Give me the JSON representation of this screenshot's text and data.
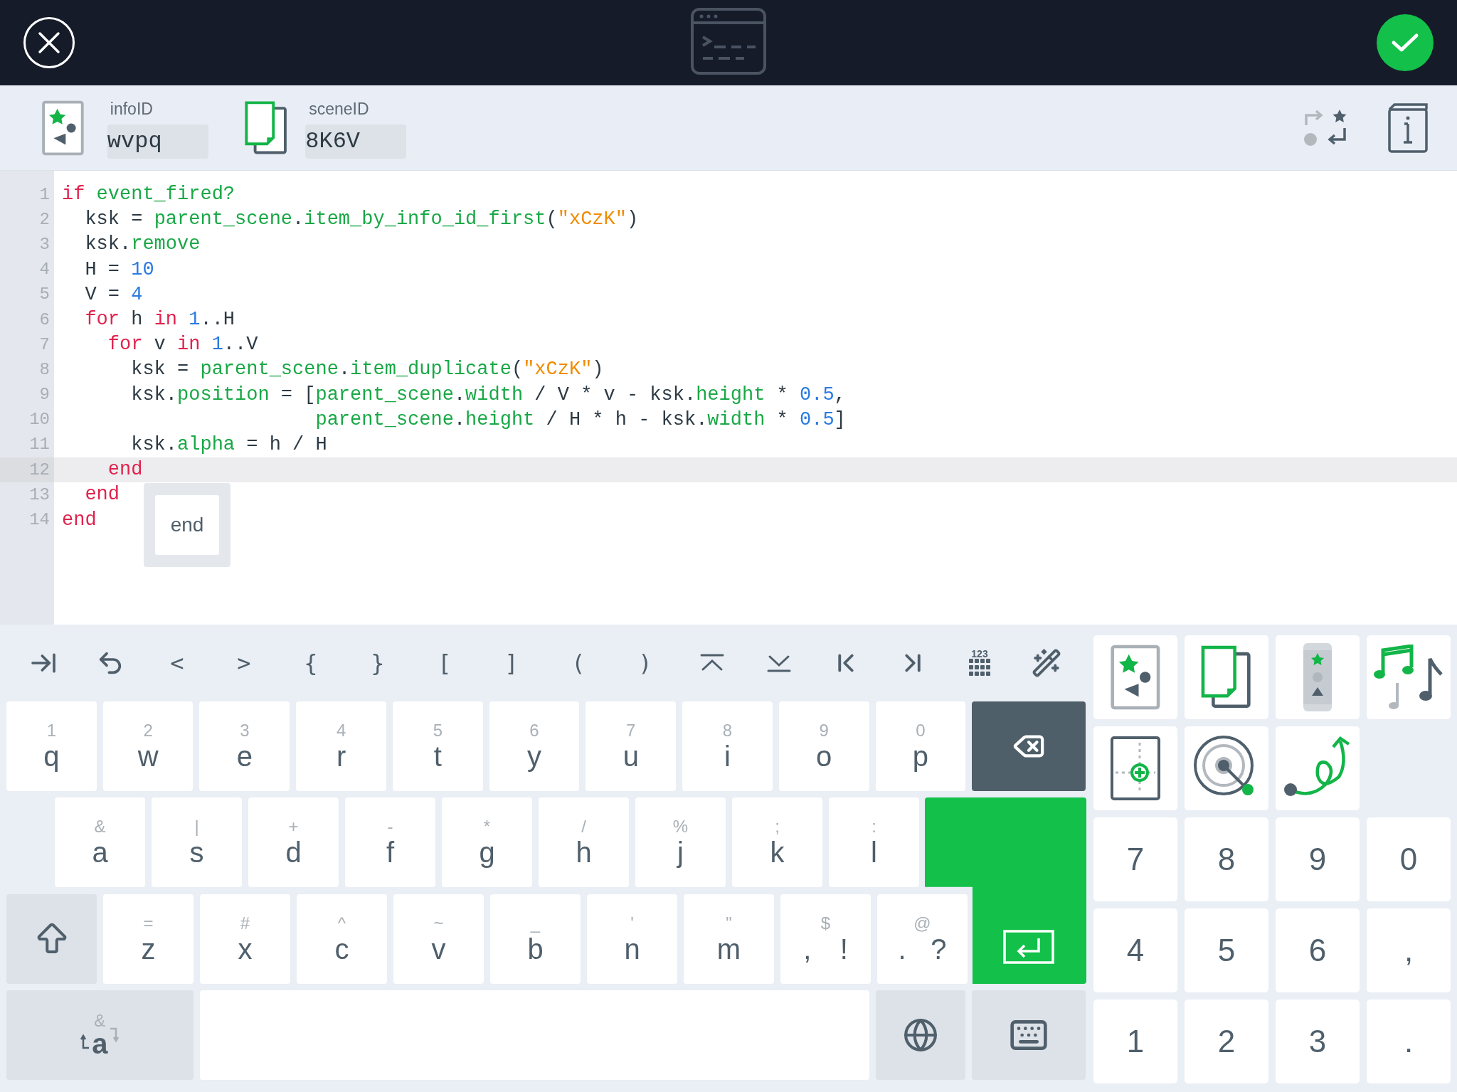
{
  "header": {
    "info_label": "infoID",
    "info_value": "wvpq",
    "scene_label": "sceneID",
    "scene_value": "8K6V"
  },
  "code": {
    "lines": [
      {
        "number": "1",
        "current": false,
        "tokens": [
          {
            "kind": "keyword",
            "text": "if "
          },
          {
            "kind": "method",
            "text": "event_fired?"
          }
        ]
      },
      {
        "number": "2",
        "current": false,
        "tokens": [
          {
            "kind": "plain",
            "text": "  ksk = "
          },
          {
            "kind": "method",
            "text": "parent_scene"
          },
          {
            "kind": "plain",
            "text": "."
          },
          {
            "kind": "method",
            "text": "item_by_info_id_first"
          },
          {
            "kind": "plain",
            "text": "("
          },
          {
            "kind": "string",
            "text": "\"xCzK\""
          },
          {
            "kind": "plain",
            "text": ")"
          }
        ]
      },
      {
        "number": "3",
        "current": false,
        "tokens": [
          {
            "kind": "plain",
            "text": "  ksk."
          },
          {
            "kind": "method",
            "text": "remove"
          }
        ]
      },
      {
        "number": "4",
        "current": false,
        "tokens": [
          {
            "kind": "plain",
            "text": "  H = "
          },
          {
            "kind": "number",
            "text": "10"
          }
        ]
      },
      {
        "number": "5",
        "current": false,
        "tokens": [
          {
            "kind": "plain",
            "text": "  V = "
          },
          {
            "kind": "number",
            "text": "4"
          }
        ]
      },
      {
        "number": "6",
        "current": false,
        "tokens": [
          {
            "kind": "keyword",
            "text": "  for"
          },
          {
            "kind": "plain",
            "text": " h "
          },
          {
            "kind": "keyword",
            "text": "in "
          },
          {
            "kind": "number",
            "text": "1"
          },
          {
            "kind": "plain",
            "text": "..H"
          }
        ]
      },
      {
        "number": "7",
        "current": false,
        "tokens": [
          {
            "kind": "keyword",
            "text": "    for"
          },
          {
            "kind": "plain",
            "text": " v "
          },
          {
            "kind": "keyword",
            "text": "in "
          },
          {
            "kind": "number",
            "text": "1"
          },
          {
            "kind": "plain",
            "text": "..V"
          }
        ]
      },
      {
        "number": "8",
        "current": false,
        "tokens": [
          {
            "kind": "plain",
            "text": "      ksk = "
          },
          {
            "kind": "method",
            "text": "parent_scene"
          },
          {
            "kind": "plain",
            "text": "."
          },
          {
            "kind": "method",
            "text": "item_duplicate"
          },
          {
            "kind": "plain",
            "text": "("
          },
          {
            "kind": "string",
            "text": "\"xCzK\""
          },
          {
            "kind": "plain",
            "text": ")"
          }
        ]
      },
      {
        "number": "9",
        "current": false,
        "tokens": [
          {
            "kind": "plain",
            "text": "      ksk."
          },
          {
            "kind": "method",
            "text": "position"
          },
          {
            "kind": "plain",
            "text": " = ["
          },
          {
            "kind": "method",
            "text": "parent_scene"
          },
          {
            "kind": "plain",
            "text": "."
          },
          {
            "kind": "method",
            "text": "width"
          },
          {
            "kind": "plain",
            "text": " / V * v - ksk."
          },
          {
            "kind": "method",
            "text": "height"
          },
          {
            "kind": "plain",
            "text": " * "
          },
          {
            "kind": "number",
            "text": "0.5"
          },
          {
            "kind": "plain",
            "text": ","
          }
        ]
      },
      {
        "number": "10",
        "current": false,
        "tokens": [
          {
            "kind": "method",
            "text": "                      parent_scene"
          },
          {
            "kind": "plain",
            "text": "."
          },
          {
            "kind": "method",
            "text": "height"
          },
          {
            "kind": "plain",
            "text": " / H * h - ksk."
          },
          {
            "kind": "method",
            "text": "width"
          },
          {
            "kind": "plain",
            "text": " * "
          },
          {
            "kind": "number",
            "text": "0.5"
          },
          {
            "kind": "plain",
            "text": "]"
          }
        ]
      },
      {
        "number": "11",
        "current": false,
        "tokens": [
          {
            "kind": "plain",
            "text": "      ksk."
          },
          {
            "kind": "method",
            "text": "alpha"
          },
          {
            "kind": "plain",
            "text": " = h / H"
          }
        ]
      },
      {
        "number": "12",
        "current": true,
        "tokens": [
          {
            "kind": "keyword",
            "text": "    end"
          }
        ]
      },
      {
        "number": "13",
        "current": false,
        "tokens": [
          {
            "kind": "keyword",
            "text": "  end"
          }
        ]
      },
      {
        "number": "14",
        "current": false,
        "tokens": [
          {
            "kind": "keyword",
            "text": "end"
          }
        ]
      }
    ],
    "suggestion": "end"
  },
  "toolbar": {
    "symbols": [
      "<",
      ">",
      "{",
      "}",
      "[",
      "]",
      "(",
      ")"
    ],
    "numpad_label": "123"
  },
  "keyboard": {
    "rows": [
      [
        {
          "hint": "1",
          "label": "q"
        },
        {
          "hint": "2",
          "label": "w"
        },
        {
          "hint": "3",
          "label": "e"
        },
        {
          "hint": "4",
          "label": "r"
        },
        {
          "hint": "5",
          "label": "t"
        },
        {
          "hint": "6",
          "label": "y"
        },
        {
          "hint": "7",
          "label": "u"
        },
        {
          "hint": "8",
          "label": "i"
        },
        {
          "hint": "9",
          "label": "o"
        },
        {
          "hint": "0",
          "label": "p"
        },
        {
          "kind": "backspace"
        }
      ],
      [
        {
          "hint": "&",
          "label": "a"
        },
        {
          "hint": "|",
          "label": "s"
        },
        {
          "hint": "+",
          "label": "d"
        },
        {
          "hint": "-",
          "label": "f"
        },
        {
          "hint": "*",
          "label": "g"
        },
        {
          "hint": "/",
          "label": "h"
        },
        {
          "hint": "%",
          "label": "j"
        },
        {
          "hint": ";",
          "label": "k"
        },
        {
          "hint": ":",
          "label": "l"
        }
      ],
      [
        {
          "kind": "shift"
        },
        {
          "hint": "=",
          "label": "z"
        },
        {
          "hint": "#",
          "label": "x"
        },
        {
          "hint": "^",
          "label": "c"
        },
        {
          "hint": "~",
          "label": "v"
        },
        {
          "hint": "_",
          "label": "b"
        },
        {
          "hint": "'",
          "label": "n"
        },
        {
          "hint": "\"",
          "label": "m"
        },
        {
          "hint": "$",
          "label": ",",
          "alt": "!"
        },
        {
          "hint": "@",
          "label": ".",
          "alt": "?"
        }
      ]
    ],
    "symbol_key": {
      "hint": "&",
      "label": "a"
    }
  },
  "numpad": [
    [
      "7",
      "8",
      "9",
      "0"
    ],
    [
      "4",
      "5",
      "6",
      ","
    ],
    [
      "1",
      "2",
      "3",
      "."
    ]
  ]
}
